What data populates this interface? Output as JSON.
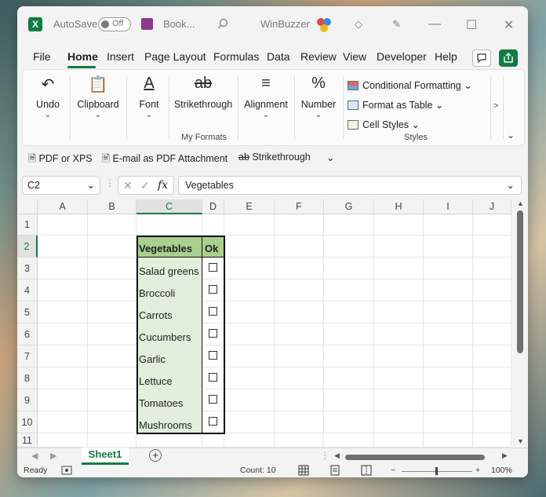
{
  "titlebar": {
    "autosave_label": "AutoSave",
    "autosave_state": "Off",
    "filename": "Book...",
    "search_icon": "search-icon",
    "brand": "WinBuzzer"
  },
  "tabs": [
    "File",
    "Home",
    "Insert",
    "Page Layout",
    "Formulas",
    "Data",
    "Review",
    "View",
    "Developer",
    "Help"
  ],
  "ribbon": {
    "undo": "Undo",
    "clipboard": "Clipboard",
    "font": "Font",
    "strikethrough": "Strikethrough",
    "my_formats": "My Formats",
    "alignment": "Alignment",
    "number": "Number",
    "number_icon": "%",
    "conditional_formatting": "Conditional Formatting",
    "format_as_table": "Format as Table",
    "cell_styles": "Cell Styles",
    "styles_group": "Styles",
    "more": ">"
  },
  "quick_access": {
    "pdf_xps": "PDF or XPS",
    "email_pdf": "E-mail as PDF Attachment",
    "strikethrough": "Strikethrough"
  },
  "formula_bar": {
    "name_box": "C2",
    "fx": "fx",
    "formula": "Vegetables"
  },
  "grid": {
    "columns": [
      "A",
      "B",
      "C",
      "D",
      "E",
      "F",
      "G",
      "H",
      "I",
      "J"
    ],
    "rows": [
      "1",
      "2",
      "3",
      "4",
      "5",
      "6",
      "7",
      "8",
      "9",
      "10",
      "11"
    ],
    "table_headers": [
      "Vegetables",
      "Ok"
    ],
    "vegetables": [
      "Salad greens",
      "Broccoli",
      "Carrots",
      "Cucumbers",
      "Garlic",
      "Lettuce",
      "Tomatoes",
      "Mushrooms"
    ],
    "checked": [
      false,
      false,
      false,
      false,
      false,
      false,
      false,
      false
    ]
  },
  "sheets": {
    "active": "Sheet1"
  },
  "status": {
    "ready": "Ready",
    "count": "Count: 10",
    "zoom": "100%"
  },
  "colors": {
    "accent": "#107c41",
    "header_fill": "#a9d08e",
    "veg_fill": "#e2efda"
  }
}
